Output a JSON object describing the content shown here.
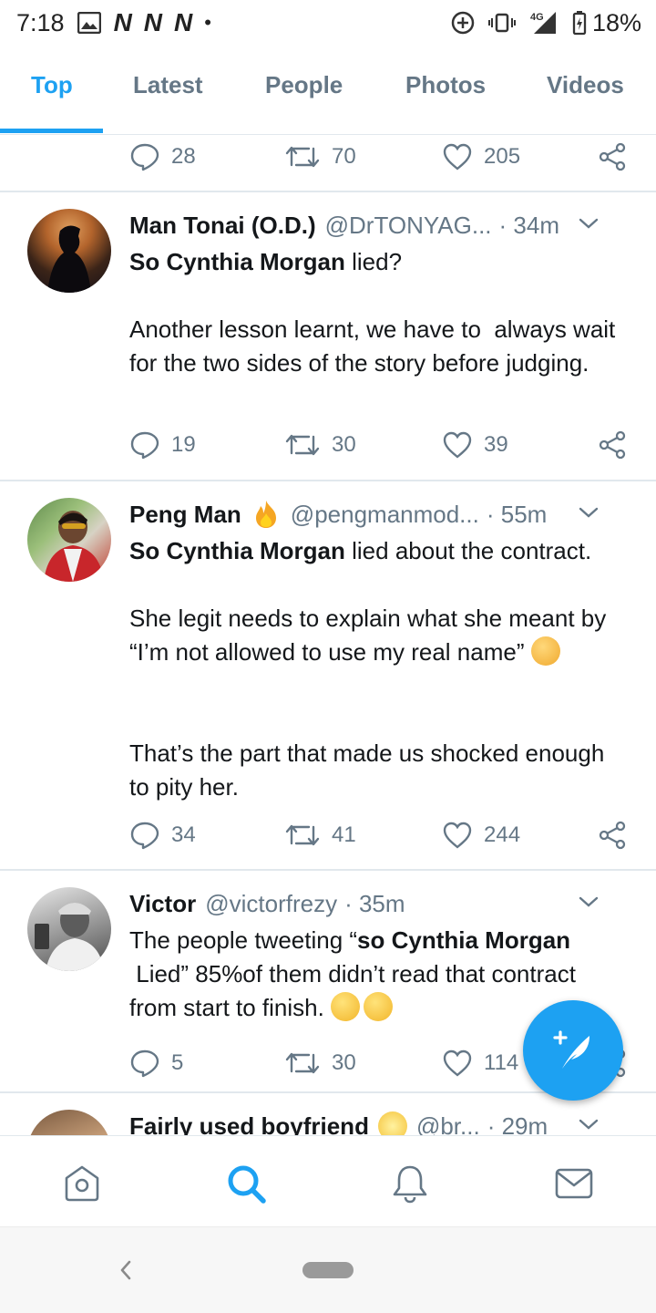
{
  "status_bar": {
    "time": "7:18",
    "network_letters": [
      "N",
      "N",
      "N"
    ],
    "network_type": "4G",
    "battery": "18%"
  },
  "tabs": [
    {
      "label": "Top",
      "active": true
    },
    {
      "label": "Latest",
      "active": false
    },
    {
      "label": "People",
      "active": false
    },
    {
      "label": "Photos",
      "active": false
    },
    {
      "label": "Videos",
      "active": false
    }
  ],
  "prev_tweet_actions": {
    "replies": "28",
    "retweets": "70",
    "likes": "205"
  },
  "tweets": [
    {
      "name": "Man Tonai (O.D.)",
      "handle": "@DrTONYAG...",
      "time": "· 34m",
      "text_bold": "So Cynthia Morgan",
      "text_rest": " lied?\n\nAnother lesson learnt, we have to  always wait for the two sides of the story before judging.",
      "replies": "19",
      "retweets": "30",
      "likes": "39"
    },
    {
      "name": "Peng Man",
      "handle": "@pengmanmod...",
      "time": "· 55m",
      "text_bold": "So Cynthia Morgan",
      "text_rest": " lied about the contract.\n\nShe legit needs to explain what she meant by “I’m not allowed to use my real name” ",
      "text_tail": "\n\n\nThat’s the part that made us shocked enough to pity her.",
      "replies": "34",
      "retweets": "41",
      "likes": "244"
    },
    {
      "name": "Victor",
      "handle": "@victorfrezy",
      "time": "· 35m",
      "text_pre": "The people tweeting “",
      "text_bold": "so Cynthia Morgan",
      "text_rest": "\n Lied” 85%of them didn’t read that contract from start to finish. ",
      "replies": "5",
      "retweets": "30",
      "likes": "114"
    },
    {
      "name": "Fairly used boyfriend",
      "handle": "@br...",
      "time": "· 29m"
    }
  ],
  "icons": {
    "reply": "reply-icon",
    "retweet": "retweet-icon",
    "like": "heart-icon",
    "share": "share-icon",
    "compose": "compose-tweet-icon",
    "home": "home-icon",
    "search": "search-icon",
    "notifications": "bell-icon",
    "messages": "mail-icon"
  },
  "colors": {
    "accent": "#1da1f2",
    "secondary_text": "#657786",
    "divider": "#e1e8ed"
  }
}
